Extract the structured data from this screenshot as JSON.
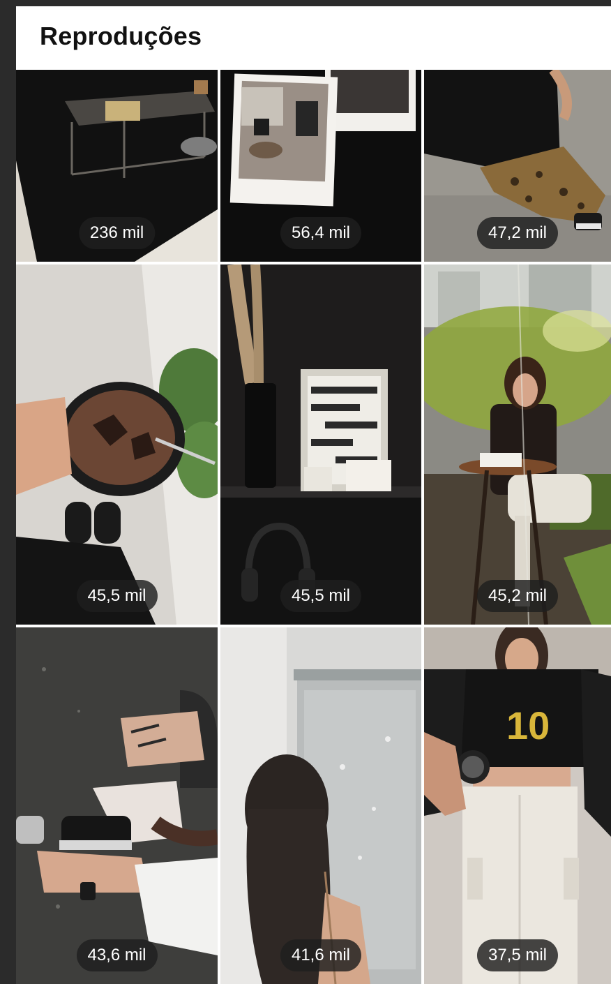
{
  "header": {
    "title": "Reproduções"
  },
  "reels": [
    {
      "plays": "236 mil",
      "icon": "coffee-table-cat-thumbnail"
    },
    {
      "plays": "56,4 mil",
      "icon": "polaroid-coffee-thumbnail"
    },
    {
      "plays": "47,2 mil",
      "icon": "leopard-pants-thumbnail"
    },
    {
      "plays": "45,5 mil",
      "icon": "chocolate-bowl-thumbnail"
    },
    {
      "plays": "45,5 mil",
      "icon": "shelf-decor-headphones-thumbnail"
    },
    {
      "plays": "45,2 mil",
      "icon": "cafe-woman-reading-thumbnail"
    },
    {
      "plays": "43,6 mil",
      "icon": "sneakers-sitting-thumbnail"
    },
    {
      "plays": "41,6 mil",
      "icon": "shower-hair-thumbnail"
    },
    {
      "plays": "37,5 mil",
      "icon": "brazil-jersey-outfit-thumbnail"
    }
  ],
  "colors": {
    "background": "#2b2b2b",
    "panel": "#ffffff",
    "badge": "#1e1e1e",
    "badge_text": "#ffffff"
  }
}
